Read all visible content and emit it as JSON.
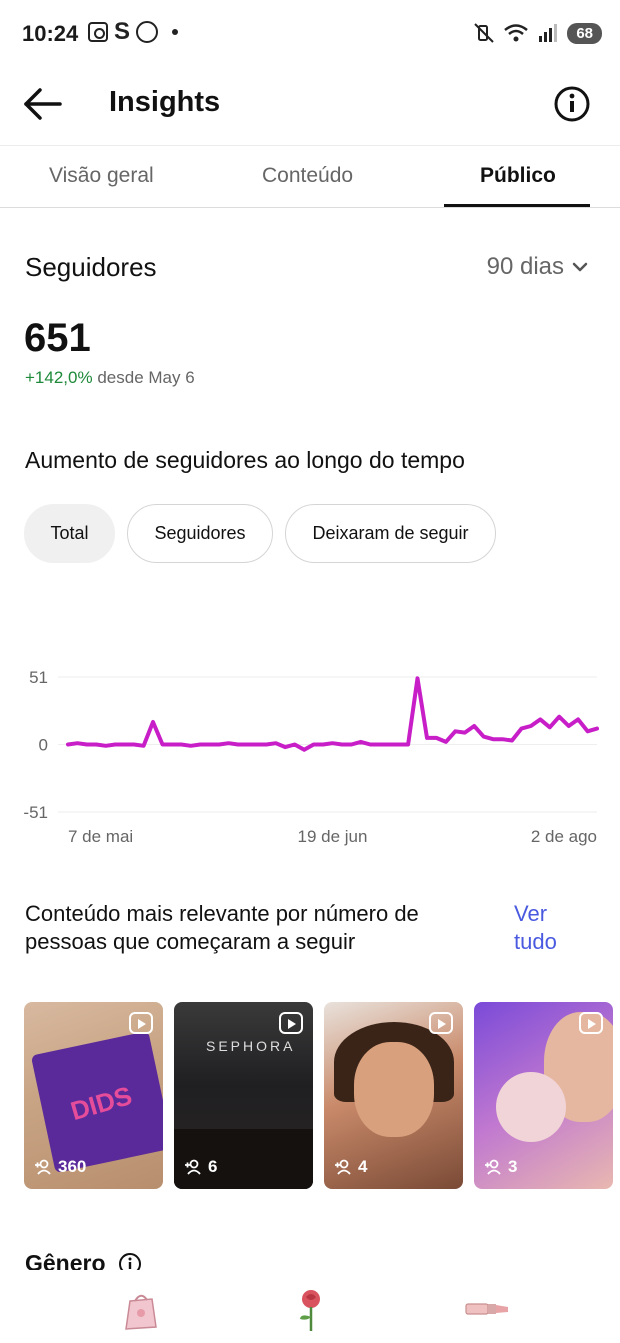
{
  "status_bar": {
    "time": "10:24",
    "battery": "68",
    "left_icons": [
      "screenshot-icon",
      "s-app-icon",
      "whatsapp-icon",
      "dot-icon"
    ],
    "right_icons": [
      "mute-vibrate-icon",
      "wifi-icon",
      "signal-icon",
      "battery-icon"
    ]
  },
  "header": {
    "title": "Insights"
  },
  "tabs": [
    {
      "label": "Visão geral",
      "active": false
    },
    {
      "label": "Conteúdo",
      "active": false
    },
    {
      "label": "Público",
      "active": true
    }
  ],
  "followers": {
    "section_title": "Seguidores",
    "range": "90 dias",
    "count": "651",
    "growth_pct": "+142,0%",
    "growth_since": "desde May 6"
  },
  "chart_section": {
    "heading": "Aumento de seguidores ao longo do tempo",
    "chips": [
      {
        "label": "Total",
        "active": true
      },
      {
        "label": "Seguidores",
        "active": false
      },
      {
        "label": "Deixaram de seguir",
        "active": false
      }
    ]
  },
  "chart_data": {
    "type": "line",
    "title": "",
    "xlabel": "",
    "ylabel": "",
    "ylim": [
      -51,
      51
    ],
    "y_ticks": [
      "51",
      "0",
      "-51"
    ],
    "x_tick_labels": [
      "7 de mai",
      "19 de jun",
      "2 de ago"
    ],
    "grid": true,
    "color": "#c81ec8",
    "values": [
      0,
      1,
      0,
      0,
      -1,
      0,
      0,
      0,
      -1,
      17,
      0,
      0,
      0,
      -1,
      0,
      0,
      0,
      1,
      0,
      0,
      0,
      0,
      1,
      -2,
      0,
      -4,
      0,
      0,
      1,
      0,
      0,
      2,
      0,
      0,
      0,
      0,
      0,
      50,
      5,
      5,
      2,
      10,
      9,
      14,
      6,
      4,
      4,
      3,
      12,
      14,
      19,
      13,
      21,
      14,
      19,
      10,
      12
    ]
  },
  "relevant": {
    "title": "Conteúdo mais relevante por número de pessoas que começaram a seguir",
    "see_all": "Ver tudo",
    "items": [
      {
        "count": "360"
      },
      {
        "count": "6",
        "sign": "SEPHORA"
      },
      {
        "count": "4"
      },
      {
        "count": "3"
      }
    ],
    "thumb_1_text": "DIDS"
  },
  "gender": {
    "title": "Gênero"
  },
  "bottom_nav": {
    "items": [
      "gift-bag-icon",
      "rose-icon",
      "lipstick-icon"
    ]
  }
}
